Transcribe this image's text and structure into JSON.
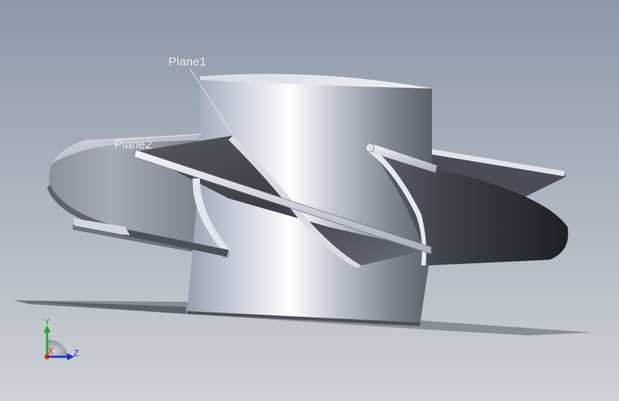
{
  "viewport": {
    "background_top": "#8c99a8",
    "background_bottom": "#c9cdd2"
  },
  "annotations": {
    "plane1_label": "Plane1",
    "plane2_label": "Plane2"
  },
  "triad": {
    "y_label": "Y",
    "z_label": "Z",
    "x_label": "X",
    "y_color": "#22aa22",
    "z_color": "#2233cc",
    "x_color": "#cc2222"
  }
}
